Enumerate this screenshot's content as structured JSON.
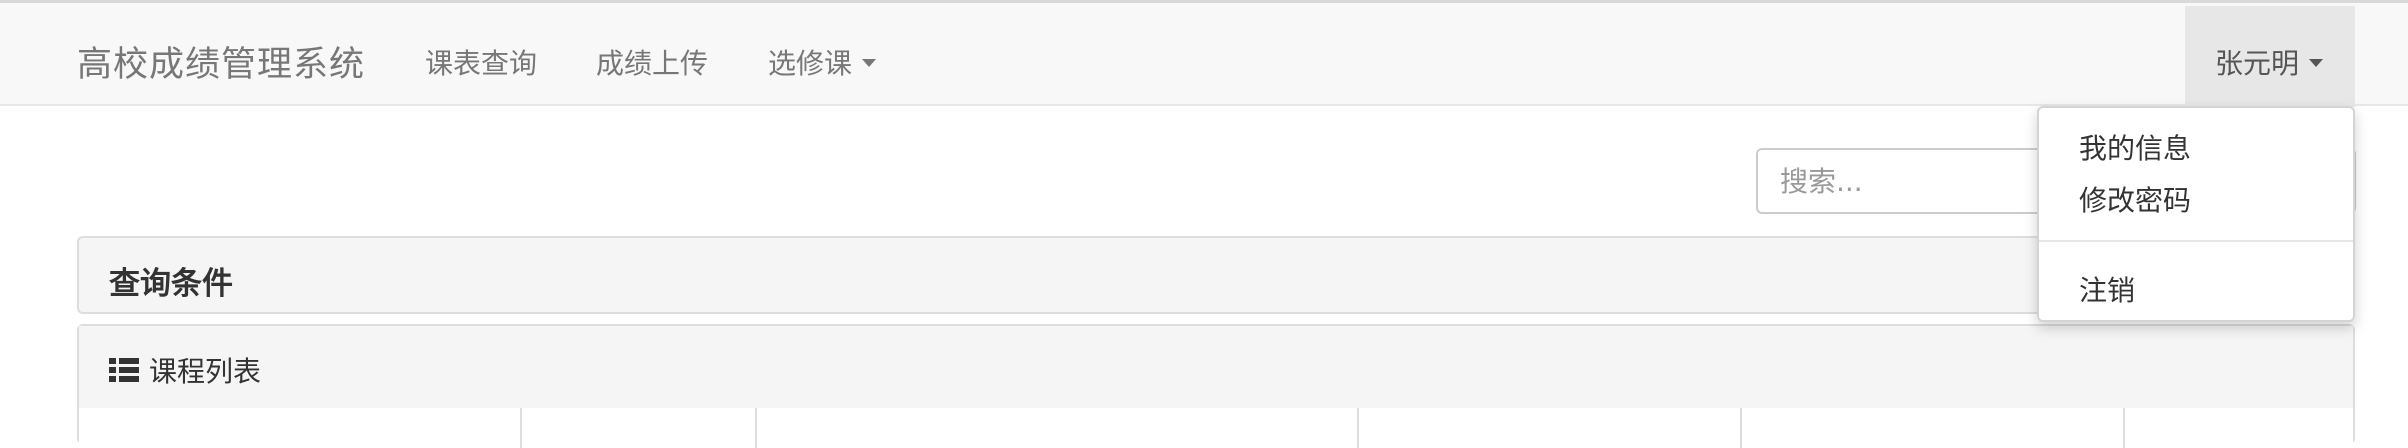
{
  "navbar": {
    "brand": "高校成绩管理系统",
    "links": [
      "课表查询",
      "成绩上传",
      "选修课"
    ],
    "user_name": "张元明"
  },
  "search": {
    "placeholder": "搜索..."
  },
  "query_panel": {
    "title": "查询条件"
  },
  "course_panel": {
    "title": "课程列表"
  },
  "user_dropdown": {
    "items": [
      "我的信息",
      "修改密码"
    ],
    "logout": "注销"
  },
  "colors": {
    "navbar_bg": "#f8f8f8",
    "panel_bg": "#f5f5f5",
    "active_bg": "#e7e7e7",
    "nav_text": "#777777"
  },
  "icons": {
    "list": "list-icon",
    "caret": "caret-down-icon"
  }
}
